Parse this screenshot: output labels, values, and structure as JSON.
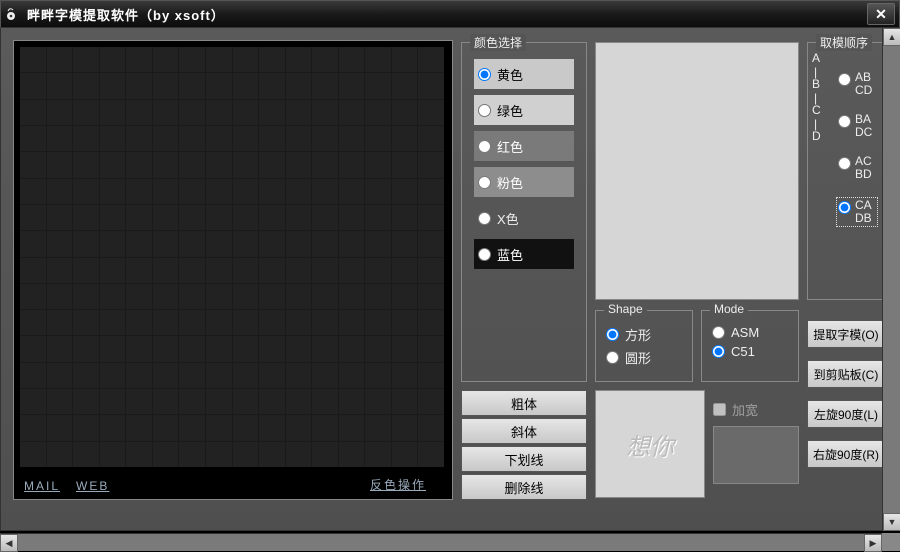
{
  "titlebar": {
    "title": "畔畔字模提取软件（by xsoft）"
  },
  "grid_footer": {
    "mail": "MAIL",
    "web": "WEB",
    "invert": "反色操作"
  },
  "color_group_title": "颜色选择",
  "colors": {
    "yellow": "黄色",
    "green": "绿色",
    "red": "红色",
    "pink": "粉色",
    "x": "X色",
    "blue": "蓝色",
    "selected": "yellow"
  },
  "style_buttons": {
    "bold": "粗体",
    "italic": "斜体",
    "underline": "下划线",
    "strike": "删除线"
  },
  "shape_group_title": "Shape",
  "shape": {
    "square": "方形",
    "circle": "圆形",
    "selected": "square"
  },
  "mode_group_title": "Mode",
  "mode": {
    "asm": "ASM",
    "c51": "C51",
    "selected": "c51"
  },
  "widen_label": "加宽",
  "widen_checked": false,
  "order_group_title": "取模顺序",
  "order_letters": [
    "A",
    "|",
    "B",
    "|",
    "C",
    "|",
    "D"
  ],
  "order_options": [
    {
      "l1": "AB",
      "l2": "CD"
    },
    {
      "l1": "BA",
      "l2": "DC"
    },
    {
      "l1": "AC",
      "l2": "BD"
    },
    {
      "l1": "CA",
      "l2": "DB"
    }
  ],
  "order_selected_index": 3,
  "action_buttons": {
    "extract": "提取字模(O)",
    "clipboard": "到剪贴板(C)",
    "rotate_left": "左旋90度(L)",
    "rotate_right": "右旋90度(R)"
  },
  "preview_small_placeholder": "想你"
}
